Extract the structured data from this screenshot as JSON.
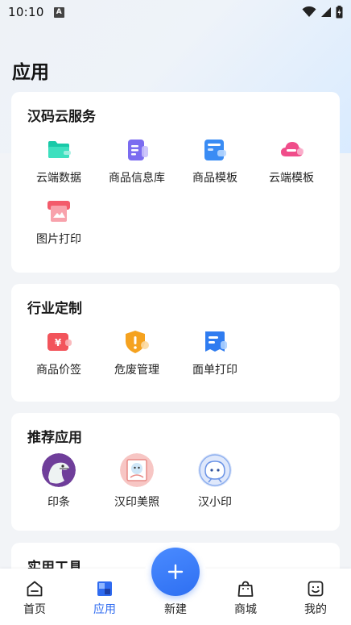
{
  "status_bar": {
    "time": "10:10",
    "a_badge": "A"
  },
  "page": {
    "title": "应用"
  },
  "sections": {
    "cloud": {
      "title": "汉码云服务",
      "items": [
        {
          "label": "云端数据",
          "icon": "folder-icon",
          "color": "#19c9a8"
        },
        {
          "label": "商品信息库",
          "icon": "product-info-icon",
          "color": "#7b6cf0"
        },
        {
          "label": "商品模板",
          "icon": "template-icon",
          "color": "#3a8cf4"
        },
        {
          "label": "云端模板",
          "icon": "cloud-icon",
          "color": "#f04d8a"
        },
        {
          "label": "图片打印",
          "icon": "image-print-icon",
          "color": "#f35b6b"
        }
      ]
    },
    "industry": {
      "title": "行业定制",
      "items": [
        {
          "label": "商品价签",
          "icon": "price-tag-icon",
          "color": "#f2545b"
        },
        {
          "label": "危废管理",
          "icon": "hazard-shield-icon",
          "color": "#f5a21f"
        },
        {
          "label": "面单打印",
          "icon": "waybill-icon",
          "color": "#2f7cf0"
        }
      ]
    },
    "recommended": {
      "title": "推荐应用",
      "items": [
        {
          "label": "印条",
          "icon": "dinosaur-avatar-icon"
        },
        {
          "label": "汉印美照",
          "icon": "photo-avatar-icon"
        },
        {
          "label": "汉小印",
          "icon": "robot-avatar-icon"
        }
      ]
    },
    "tools": {
      "title": "实用工具"
    }
  },
  "bottom_nav": {
    "home": "首页",
    "apps": "应用",
    "new": "新建",
    "mall": "商城",
    "mine": "我的",
    "active": "apps",
    "accent": "#2f6bf0"
  }
}
